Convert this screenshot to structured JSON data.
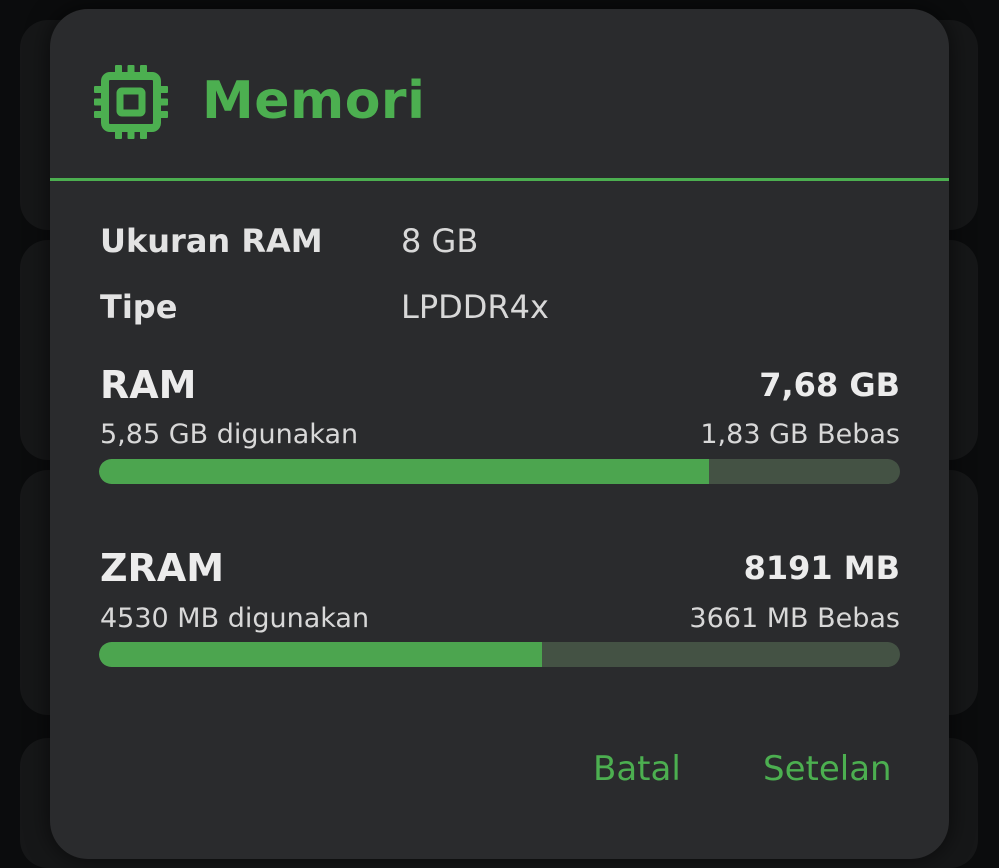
{
  "dialog": {
    "title": "Memori",
    "icon": "memory-chip-icon",
    "accent_color": "#4caf50"
  },
  "info": {
    "ram_size_label": "Ukuran RAM",
    "ram_size_value": "8 GB",
    "type_label": "Tipe",
    "type_value": "LPDDR4x"
  },
  "ram": {
    "title": "RAM",
    "total": "7,68 GB",
    "used": "5,85 GB digunakan",
    "free": "1,83 GB Bebas",
    "used_fraction": 0.762
  },
  "zram": {
    "title": "ZRAM",
    "total": "8191 MB",
    "used": "4530 MB digunakan",
    "free": "3661 MB Bebas",
    "used_fraction": 0.553
  },
  "actions": {
    "cancel_label": "Batal",
    "settings_label": "Setelan"
  }
}
